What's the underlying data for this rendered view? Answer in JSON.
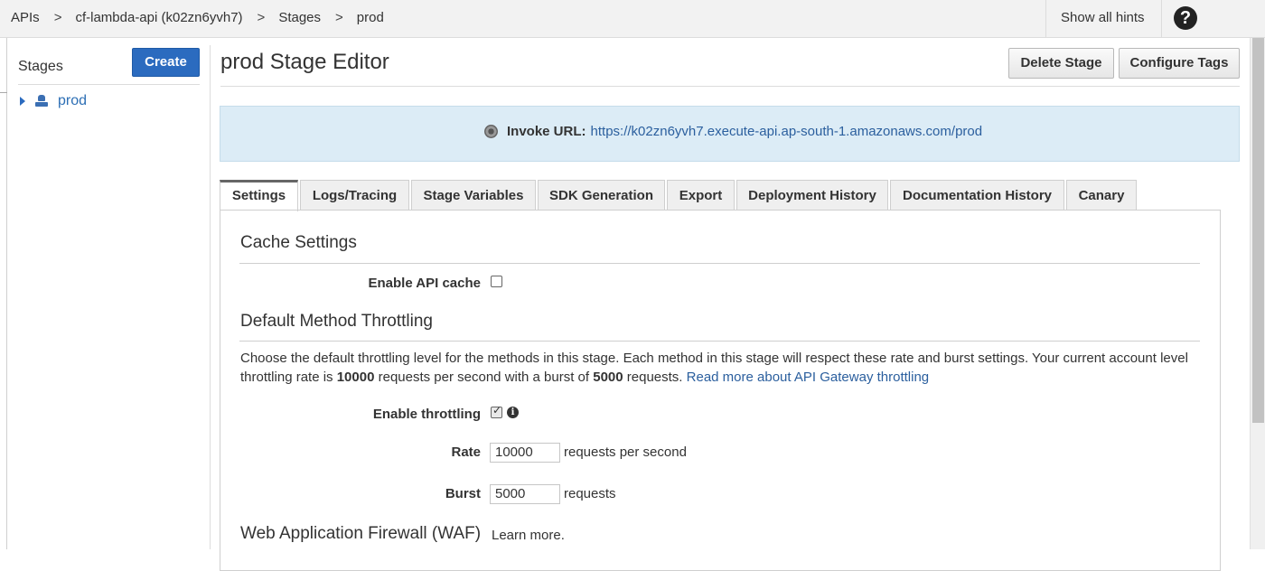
{
  "breadcrumb": {
    "items": [
      "APIs",
      "cf-lambda-api (k02zn6yvh7)",
      "Stages",
      "prod"
    ],
    "separator": ">"
  },
  "topbar": {
    "show_hints": "Show all hints",
    "help_glyph": "?"
  },
  "sidebar": {
    "title": "Stages",
    "create_label": "Create",
    "items": [
      {
        "label": "prod",
        "icon": "stage-icon"
      }
    ]
  },
  "header": {
    "title": "prod Stage Editor",
    "delete_label": "Delete Stage",
    "tags_label": "Configure Tags"
  },
  "invoke": {
    "label": "Invoke URL:",
    "url": "https://k02zn6yvh7.execute-api.ap-south-1.amazonaws.com/prod"
  },
  "tabs": [
    {
      "label": "Settings",
      "active": true
    },
    {
      "label": "Logs/Tracing"
    },
    {
      "label": "Stage Variables"
    },
    {
      "label": "SDK Generation"
    },
    {
      "label": "Export"
    },
    {
      "label": "Deployment History"
    },
    {
      "label": "Documentation History"
    },
    {
      "label": "Canary"
    }
  ],
  "cache": {
    "heading": "Cache Settings",
    "enable_label": "Enable API cache",
    "enabled": false
  },
  "throttling": {
    "heading": "Default Method Throttling",
    "desc_1": "Choose the default throttling level for the methods in this stage. Each method in this stage will respect these rate and burst settings. Your current account level throttling rate is ",
    "rate_limit": "10000",
    "desc_2": " requests per second with a burst of ",
    "burst_limit": "5000",
    "desc_3": " requests. ",
    "read_more": "Read more about API Gateway throttling",
    "enable_label": "Enable throttling",
    "enabled": true,
    "rate_label": "Rate",
    "rate_value": "10000",
    "rate_unit": "requests per second",
    "burst_label": "Burst",
    "burst_value": "5000",
    "burst_unit": "requests"
  },
  "waf": {
    "heading": "Web Application Firewall (WAF)",
    "learn_more": "Learn more."
  },
  "colors": {
    "primary": "#2b6bbf",
    "link": "#2b5f9e",
    "invoke_bg": "#dcecf6"
  }
}
